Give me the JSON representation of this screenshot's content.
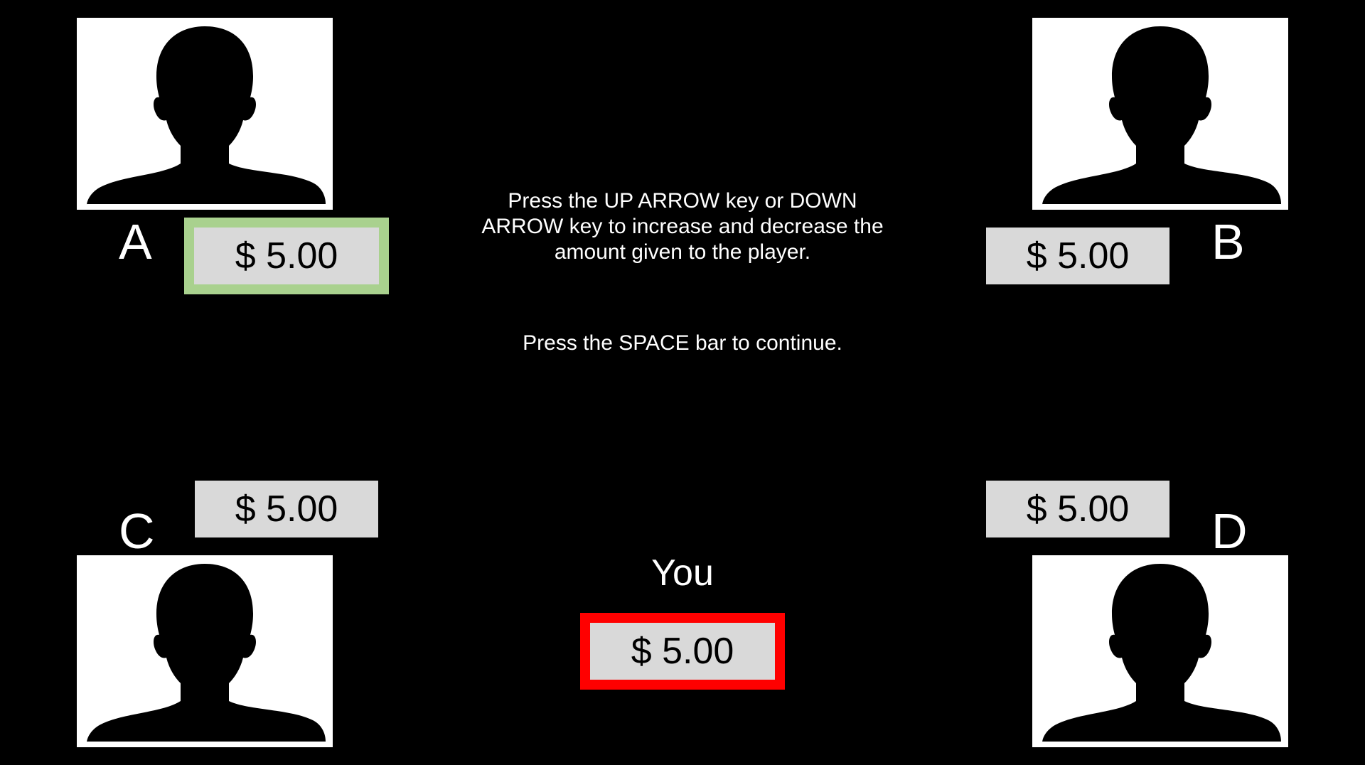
{
  "instructions": {
    "adjust_text": "Press the UP ARROW key or DOWN ARROW key to increase and decrease the amount given to the player.",
    "continue_text": "Press the SPACE bar to continue."
  },
  "players": {
    "a": {
      "label": "A",
      "amount": "$ 5.00",
      "highlight_color": "#a9d18e"
    },
    "b": {
      "label": "B",
      "amount": "$ 5.00"
    },
    "c": {
      "label": "C",
      "amount": "$ 5.00"
    },
    "d": {
      "label": "D",
      "amount": "$ 5.00"
    }
  },
  "self": {
    "label": "You",
    "amount": "$ 5.00",
    "border_color": "#ff0000"
  },
  "icons": {
    "avatar": "person-silhouette-icon"
  },
  "colors": {
    "background": "#000000",
    "amount_box": "#d9d9d9",
    "text": "#ffffff"
  }
}
